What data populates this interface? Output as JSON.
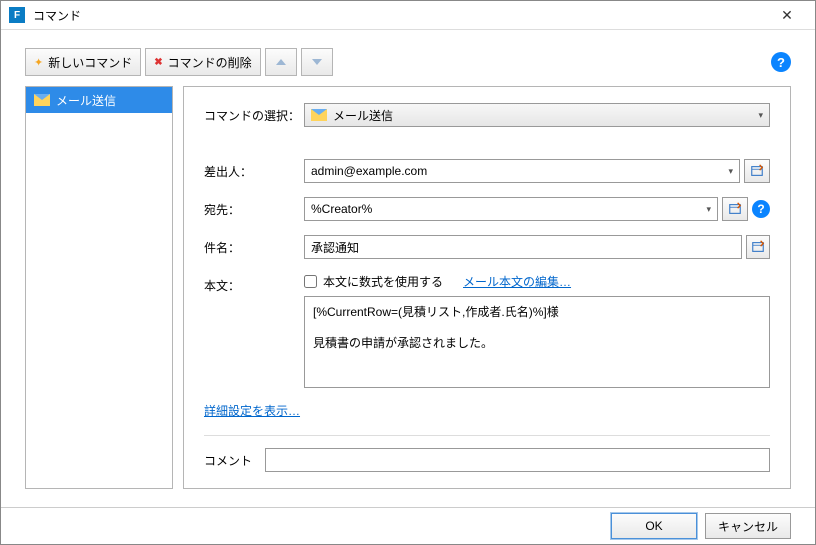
{
  "window": {
    "title": "コマンド"
  },
  "toolbar": {
    "new_command": "新しいコマンド",
    "delete_command": "コマンドの削除"
  },
  "sidebar": {
    "items": [
      {
        "label": "メール送信"
      }
    ]
  },
  "form": {
    "command_select_label": "コマンドの選択：",
    "command_select_value": "メール送信",
    "from_label": "差出人：",
    "from_value": "admin@example.com",
    "to_label": "宛先：",
    "to_value": "%Creator%",
    "subject_label": "件名：",
    "subject_value": "承認通知",
    "body_label": "本文：",
    "use_formula_label": "本文に数式を使用する",
    "edit_body_link": "メール本文の編集…",
    "body_text": "[%CurrentRow=(見積リスト,作成者.氏名)%]様\n\n見積書の申請が承認されました。",
    "advanced_link": "詳細設定を表示…",
    "comment_label": "コメント",
    "comment_value": ""
  },
  "footer": {
    "ok": "OK",
    "cancel": "キャンセル"
  }
}
